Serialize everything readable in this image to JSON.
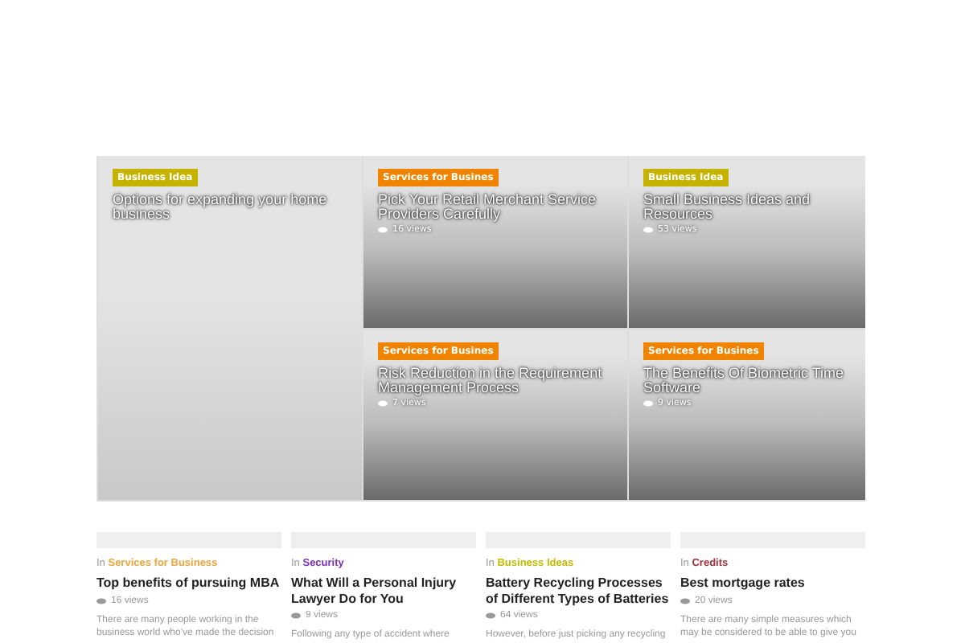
{
  "featured": [
    {
      "badge": "Business Idea",
      "color": "#c5b300",
      "title": "Options for expanding your home business"
    },
    {
      "badge": "Services for Busines",
      "color": "#f08400",
      "title": "Pick Your Retail Merchant Service Providers Carefully",
      "views": "16 views"
    },
    {
      "badge": "Business Idea",
      "color": "#c5b300",
      "title": "Small Business Ideas and Resources",
      "views": "53 views"
    },
    {
      "badge": "Services for Busines",
      "color": "#f08400",
      "title": "Risk Reduction in the Requirement Management Process",
      "views": "7 views"
    },
    {
      "badge": "Services for Busines",
      "color": "#f08400",
      "title": "The Benefits Of Biometric Time Software",
      "views": "9 views"
    }
  ],
  "posts": [
    {
      "in": "In",
      "category": "Services for Business",
      "color": "#eea43c",
      "title": "Top benefits of pursuing MBA",
      "views": "16 views",
      "excerpt": "There are many people working in the business world who've made the decision"
    },
    {
      "in": "In",
      "category": "Security",
      "color": "#7a2fc0",
      "title": "What Will a Personal Injury Lawyer Do for You",
      "views": "9 views",
      "excerpt": "Following any type of accident where"
    },
    {
      "in": "In",
      "category": "Business Ideas",
      "color": "#c8b800",
      "title": "Battery Recycling Processes of Different Types of Batteries",
      "views": "64 views",
      "excerpt": "However, before just picking any recycling"
    },
    {
      "in": "In",
      "category": "Credits",
      "color": "#a3303c",
      "title": "Best mortgage rates",
      "views": "20 views",
      "excerpt": "There are many simple measures which may be considered to be able to give you"
    }
  ]
}
